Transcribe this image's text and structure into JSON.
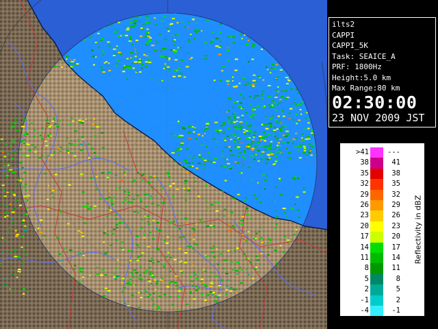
{
  "info": {
    "station": "ilts2",
    "product": "CAPPI",
    "product_code": "CAPPI_5K",
    "task": "Task: SEAICE_A",
    "prf": "PRF: 1800Hz",
    "height": "Height:5.0 km",
    "max_range": "Max Range:80 km",
    "time": "02:30:00",
    "date": "23 NOV 2009 JST"
  },
  "legend": {
    "title": "Reflectivity in dBZ",
    "rows": [
      {
        "lo": ">41",
        "hi": "---",
        "color": "#ff33ff"
      },
      {
        "lo": "38",
        "hi": "41",
        "color": "#cc0088"
      },
      {
        "lo": "35",
        "hi": "38",
        "color": "#e30000"
      },
      {
        "lo": "32",
        "hi": "35",
        "color": "#ff3300"
      },
      {
        "lo": "29",
        "hi": "32",
        "color": "#ff6600"
      },
      {
        "lo": "26",
        "hi": "29",
        "color": "#ff9900"
      },
      {
        "lo": "23",
        "hi": "26",
        "color": "#ffcc00"
      },
      {
        "lo": "20",
        "hi": "23",
        "color": "#ffff00"
      },
      {
        "lo": "17",
        "hi": "20",
        "color": "#ccff00"
      },
      {
        "lo": "14",
        "hi": "17",
        "color": "#00dd00"
      },
      {
        "lo": "11",
        "hi": "14",
        "color": "#00bb00"
      },
      {
        "lo": "8",
        "hi": "11",
        "color": "#009900"
      },
      {
        "lo": "5",
        "hi": "8",
        "color": "#008866"
      },
      {
        "lo": "2",
        "hi": "5",
        "color": "#00aa99"
      },
      {
        "lo": "-1",
        "hi": "2",
        "color": "#00cccc"
      },
      {
        "lo": "-4",
        "hi": "-1",
        "color": "#33eeff"
      }
    ]
  },
  "colors": {
    "sea_outside": "#2a5fd6",
    "sea_inside": "#1f8fff",
    "land": "#7a6a55",
    "land_inside": "#a08a6e",
    "rivers": "#5a6cff",
    "boundaries": "#c83a3a",
    "coast": "#0a1a40"
  }
}
